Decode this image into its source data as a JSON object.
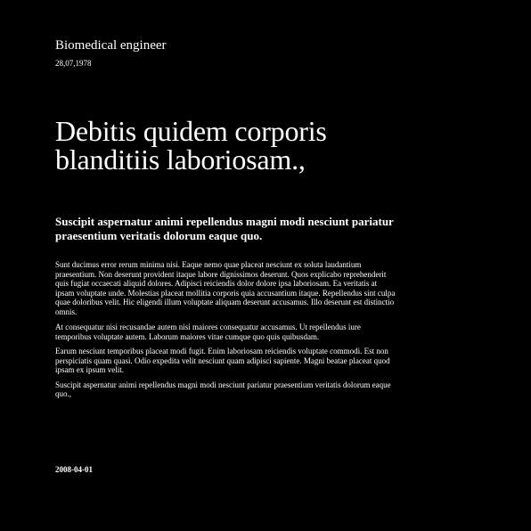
{
  "header": {
    "role": "Biomedical engineer",
    "date": "28,07,1978"
  },
  "headline": {
    "lines": [
      "Debitis quidem corporis",
      "blanditiis laboriosam.,"
    ]
  },
  "subheading": {
    "lines": [
      "Suscipit aspernatur animi repellendus magni modi nesciunt pariatur",
      "praesentium veritatis dolorum eaque quo."
    ]
  },
  "body": {
    "paragraphs": [
      {
        "lines": [
          "Sunt ducimus error rerum minima nisi. Eaque nemo quae placeat nesciunt ex soluta laudantium",
          "praesentium. Non deserunt provident itaque labore dignissimos deserunt. Quos explicabo reprehenderit",
          "quis fugiat occaecati aliquid dolores. Adipisci reiciendis dolor dolore ipsa laboriosam. Ea veritatis at",
          "ipsam voluptate unde. Molestias placeat mollitia corporis quia accusantium itaque. Repellendus sint culpa",
          "quae doloribus velit. Hic eligendi illum voluptate aliquam deserunt accusamus. Illo deserunt est distinctio",
          "omnis."
        ]
      },
      {
        "lines": [
          "At consequatur nisi recusandae autem nisi maiores consequatur accusamus. Ut repellendus iure",
          "temporibus voluptate autem. Laborum maiores vitae cumque quo quis quibusdam."
        ]
      },
      {
        "lines": [
          "Earum nesciunt temporibus placeat modi fugit. Enim laboriosam reiciendis voluptate commodi. Est non",
          "perspiciatis quam quasi. Odio expedita velit nesciunt quam adipisci sapiente. Magni beatae placeat quod",
          "ipsam ex ipsum velit."
        ]
      },
      {
        "lines": [
          "Suscipit aspernatur animi repellendus magni modi nesciunt pariatur praesentium veritatis dolorum eaque",
          "quo.,"
        ]
      }
    ]
  },
  "footer": {
    "date": "2008-04-01"
  }
}
